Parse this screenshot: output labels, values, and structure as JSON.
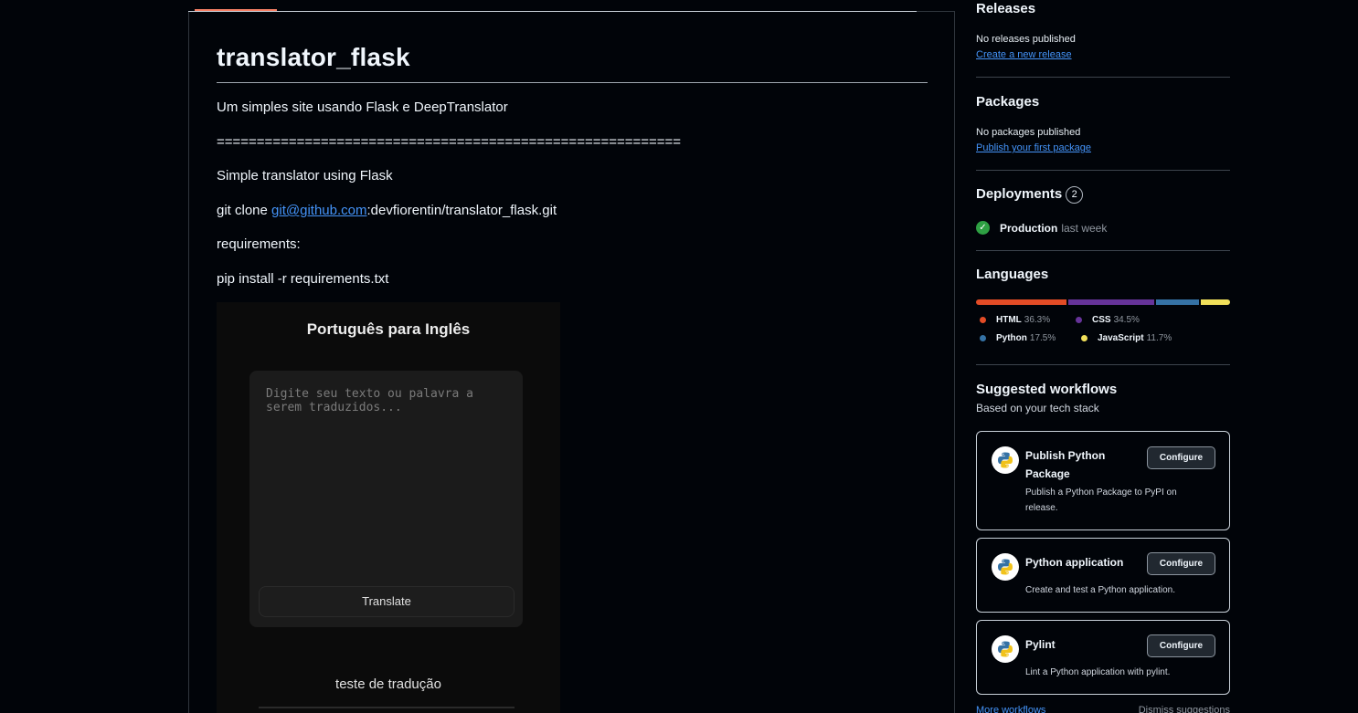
{
  "readme": {
    "title": "translator_flask",
    "description": "Um simples site usando Flask e DeepTranslator",
    "separator": "==========================================================",
    "subtitle": "Simple translator using Flask",
    "clone_prefix": "git clone ",
    "clone_link": "git@github.com",
    "clone_suffix": ":devfiorentin/translator_flask.git",
    "requirements_label": "requirements:",
    "install_cmd": "pip install -r requirements.txt",
    "screenshot": {
      "title": "Português para Inglês",
      "placeholder": "Digite seu texto ou palavra a\nserem traduzidos...",
      "button": "Translate",
      "result": "teste de tradução"
    }
  },
  "sidebar": {
    "releases": {
      "title": "Releases",
      "empty": "No releases published",
      "link": "Create a new release"
    },
    "packages": {
      "title": "Packages",
      "empty": "No packages published",
      "link": "Publish your first package"
    },
    "deployments": {
      "title": "Deployments",
      "count": "2",
      "env": "Production",
      "time": "last week"
    },
    "languages": {
      "title": "Languages",
      "items": [
        {
          "name": "HTML",
          "percent": "36.3%",
          "value": 36.3,
          "color": "#e34c26"
        },
        {
          "name": "CSS",
          "percent": "34.5%",
          "value": 34.5,
          "color": "#663399"
        },
        {
          "name": "Python",
          "percent": "17.5%",
          "value": 17.5,
          "color": "#3572a5"
        },
        {
          "name": "JavaScript",
          "percent": "11.7%",
          "value": 11.7,
          "color": "#f1e05a"
        }
      ]
    },
    "workflows": {
      "title": "Suggested workflows",
      "subtitle": "Based on your tech stack",
      "configure_label": "Configure",
      "items": [
        {
          "name": "Publish Python Package",
          "desc": "Publish a Python Package to PyPI on release.",
          "icon": "python-logo-icon"
        },
        {
          "name": "Python application",
          "desc": "Create and test a Python application.",
          "icon": "python-logo-icon"
        },
        {
          "name": "Pylint",
          "desc": "Lint a Python application with pylint.",
          "icon": "python-logo-icon"
        }
      ],
      "more": "More workflows",
      "dismiss": "Dismiss suggestions"
    }
  }
}
